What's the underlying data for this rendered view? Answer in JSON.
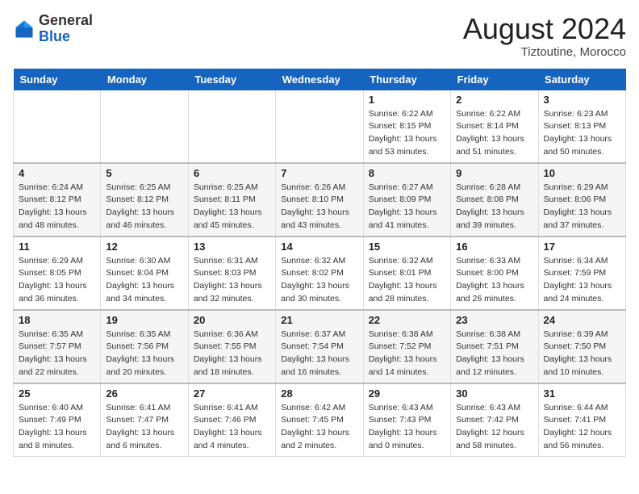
{
  "header": {
    "logo": {
      "general": "General",
      "blue": "Blue"
    },
    "title": "August 2024",
    "location": "Tiztoutine, Morocco"
  },
  "weekdays": [
    "Sunday",
    "Monday",
    "Tuesday",
    "Wednesday",
    "Thursday",
    "Friday",
    "Saturday"
  ],
  "weeks": [
    [
      {
        "day": "",
        "info": ""
      },
      {
        "day": "",
        "info": ""
      },
      {
        "day": "",
        "info": ""
      },
      {
        "day": "",
        "info": ""
      },
      {
        "day": "1",
        "info": "Sunrise: 6:22 AM\nSunset: 8:15 PM\nDaylight: 13 hours\nand 53 minutes."
      },
      {
        "day": "2",
        "info": "Sunrise: 6:22 AM\nSunset: 8:14 PM\nDaylight: 13 hours\nand 51 minutes."
      },
      {
        "day": "3",
        "info": "Sunrise: 6:23 AM\nSunset: 8:13 PM\nDaylight: 13 hours\nand 50 minutes."
      }
    ],
    [
      {
        "day": "4",
        "info": "Sunrise: 6:24 AM\nSunset: 8:12 PM\nDaylight: 13 hours\nand 48 minutes."
      },
      {
        "day": "5",
        "info": "Sunrise: 6:25 AM\nSunset: 8:12 PM\nDaylight: 13 hours\nand 46 minutes."
      },
      {
        "day": "6",
        "info": "Sunrise: 6:25 AM\nSunset: 8:11 PM\nDaylight: 13 hours\nand 45 minutes."
      },
      {
        "day": "7",
        "info": "Sunrise: 6:26 AM\nSunset: 8:10 PM\nDaylight: 13 hours\nand 43 minutes."
      },
      {
        "day": "8",
        "info": "Sunrise: 6:27 AM\nSunset: 8:09 PM\nDaylight: 13 hours\nand 41 minutes."
      },
      {
        "day": "9",
        "info": "Sunrise: 6:28 AM\nSunset: 8:08 PM\nDaylight: 13 hours\nand 39 minutes."
      },
      {
        "day": "10",
        "info": "Sunrise: 6:29 AM\nSunset: 8:06 PM\nDaylight: 13 hours\nand 37 minutes."
      }
    ],
    [
      {
        "day": "11",
        "info": "Sunrise: 6:29 AM\nSunset: 8:05 PM\nDaylight: 13 hours\nand 36 minutes."
      },
      {
        "day": "12",
        "info": "Sunrise: 6:30 AM\nSunset: 8:04 PM\nDaylight: 13 hours\nand 34 minutes."
      },
      {
        "day": "13",
        "info": "Sunrise: 6:31 AM\nSunset: 8:03 PM\nDaylight: 13 hours\nand 32 minutes."
      },
      {
        "day": "14",
        "info": "Sunrise: 6:32 AM\nSunset: 8:02 PM\nDaylight: 13 hours\nand 30 minutes."
      },
      {
        "day": "15",
        "info": "Sunrise: 6:32 AM\nSunset: 8:01 PM\nDaylight: 13 hours\nand 28 minutes."
      },
      {
        "day": "16",
        "info": "Sunrise: 6:33 AM\nSunset: 8:00 PM\nDaylight: 13 hours\nand 26 minutes."
      },
      {
        "day": "17",
        "info": "Sunrise: 6:34 AM\nSunset: 7:59 PM\nDaylight: 13 hours\nand 24 minutes."
      }
    ],
    [
      {
        "day": "18",
        "info": "Sunrise: 6:35 AM\nSunset: 7:57 PM\nDaylight: 13 hours\nand 22 minutes."
      },
      {
        "day": "19",
        "info": "Sunrise: 6:35 AM\nSunset: 7:56 PM\nDaylight: 13 hours\nand 20 minutes."
      },
      {
        "day": "20",
        "info": "Sunrise: 6:36 AM\nSunset: 7:55 PM\nDaylight: 13 hours\nand 18 minutes."
      },
      {
        "day": "21",
        "info": "Sunrise: 6:37 AM\nSunset: 7:54 PM\nDaylight: 13 hours\nand 16 minutes."
      },
      {
        "day": "22",
        "info": "Sunrise: 6:38 AM\nSunset: 7:52 PM\nDaylight: 13 hours\nand 14 minutes."
      },
      {
        "day": "23",
        "info": "Sunrise: 6:38 AM\nSunset: 7:51 PM\nDaylight: 13 hours\nand 12 minutes."
      },
      {
        "day": "24",
        "info": "Sunrise: 6:39 AM\nSunset: 7:50 PM\nDaylight: 13 hours\nand 10 minutes."
      }
    ],
    [
      {
        "day": "25",
        "info": "Sunrise: 6:40 AM\nSunset: 7:49 PM\nDaylight: 13 hours\nand 8 minutes."
      },
      {
        "day": "26",
        "info": "Sunrise: 6:41 AM\nSunset: 7:47 PM\nDaylight: 13 hours\nand 6 minutes."
      },
      {
        "day": "27",
        "info": "Sunrise: 6:41 AM\nSunset: 7:46 PM\nDaylight: 13 hours\nand 4 minutes."
      },
      {
        "day": "28",
        "info": "Sunrise: 6:42 AM\nSunset: 7:45 PM\nDaylight: 13 hours\nand 2 minutes."
      },
      {
        "day": "29",
        "info": "Sunrise: 6:43 AM\nSunset: 7:43 PM\nDaylight: 13 hours\nand 0 minutes."
      },
      {
        "day": "30",
        "info": "Sunrise: 6:43 AM\nSunset: 7:42 PM\nDaylight: 12 hours\nand 58 minutes."
      },
      {
        "day": "31",
        "info": "Sunrise: 6:44 AM\nSunset: 7:41 PM\nDaylight: 12 hours\nand 56 minutes."
      }
    ]
  ]
}
